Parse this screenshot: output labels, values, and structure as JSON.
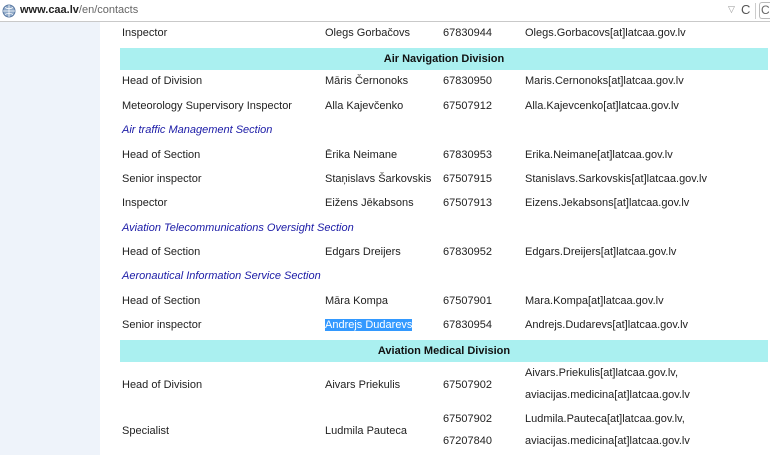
{
  "browser": {
    "url_host": "www.caa.lv",
    "url_path": "/en/contacts",
    "dropdown_glyph": "▽",
    "reload_glyph": "C",
    "search_glyph": "C"
  },
  "contacts": {
    "partial_row": {
      "position": "Inspector",
      "name": "Olegs Gorbačovs",
      "phone": "67830944",
      "email": "Olegs.Gorbacovs[at]latcaa.gov.lv"
    },
    "air_nav_title": "Air Navigation Division",
    "air_nav": [
      {
        "position": "Head of Division",
        "name": "Māris Černonoks",
        "phone": "67830950",
        "email": "Maris.Cernonoks[at]latcaa.gov.lv"
      },
      {
        "position": "Meteorology Supervisory Inspector",
        "name": "Alla Kajevčenko",
        "phone": "67507912",
        "email": "Alla.Kajevcenko[at]latcaa.gov.lv"
      }
    ],
    "atm_section": "Air traffic Management Section",
    "atm": [
      {
        "position": "Head of Section",
        "name": "Ērika Neimane",
        "phone": "67830953",
        "email": "Erika.Neimane[at]latcaa.gov.lv"
      },
      {
        "position": "Senior inspector",
        "name": "Staņislavs Šarkovskis",
        "phone": "67507915",
        "email": "Stanislavs.Sarkovskis[at]latcaa.gov.lv"
      },
      {
        "position": "Inspector",
        "name": "Eižens Jēkabsons",
        "phone": "67507913",
        "email": "Eizens.Jekabsons[at]latcaa.gov.lv"
      }
    ],
    "telecom_section": "Aviation Telecommunications Oversight Section",
    "telecom": [
      {
        "position": "Head of Section",
        "name": "Edgars Dreijers",
        "phone": "67830952",
        "email": "Edgars.Dreijers[at]latcaa.gov.lv"
      }
    ],
    "ais_section": "Aeronautical Information Service Section",
    "ais": [
      {
        "position": "Head of Section",
        "name": "Māra Kompa",
        "phone": "67507901",
        "email": "Mara.Kompa[at]latcaa.gov.lv"
      },
      {
        "position": "Senior inspector",
        "name": "Andrejs Dudarevs",
        "phone": "67830954",
        "email": "Andrejs.Dudarevs[at]latcaa.gov.lv"
      }
    ],
    "medical_title": "Aviation Medical Division",
    "medical": [
      {
        "position": "Head of Division",
        "name": "Aivars Priekulis",
        "phone": "67507902",
        "email_line1": "Aivars.Priekulis[at]latcaa.gov.lv,",
        "email_line2": "aviacijas.medicina[at]latcaa.gov.lv"
      },
      {
        "position": "Specialist",
        "name": "Ludmila Pauteca",
        "phone_line1": "67507902",
        "phone_line2": "67207840",
        "email_line1": "Ludmila.Pauteca[at]latcaa.gov.lv,",
        "email_line2": "aviacijas.medicina[at]latcaa.gov.lv"
      }
    ]
  }
}
